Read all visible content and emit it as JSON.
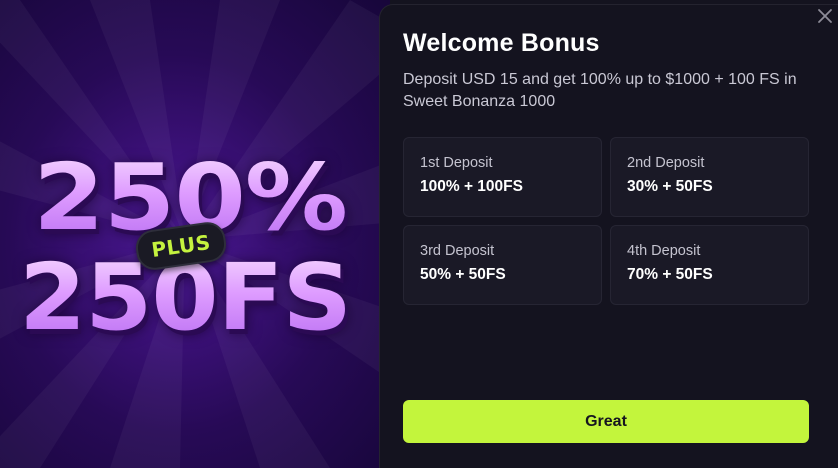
{
  "promo": {
    "line1": "250%",
    "badge": "PLUS",
    "line2": "250FS",
    "colors": {
      "text": "#e2a6ff",
      "badge_text": "#c5f33f",
      "background": "#3a1076"
    }
  },
  "dialog": {
    "title": "Welcome Bonus",
    "subtitle": "Deposit USD 15 and get 100% up to $1000 + 100 FS in Sweet Bonanza 1000",
    "close_icon": "close-icon",
    "deposits": [
      {
        "label": "1st Deposit",
        "value": "100% + 100FS"
      },
      {
        "label": "2nd Deposit",
        "value": "30% + 50FS"
      },
      {
        "label": "3rd Deposit",
        "value": "50% + 50FS"
      },
      {
        "label": "4th Deposit",
        "value": "70% + 50FS"
      }
    ],
    "button_label": "Great",
    "colors": {
      "accent": "#c3f53c",
      "panel": "#14131f",
      "card": "#1a1926"
    }
  }
}
